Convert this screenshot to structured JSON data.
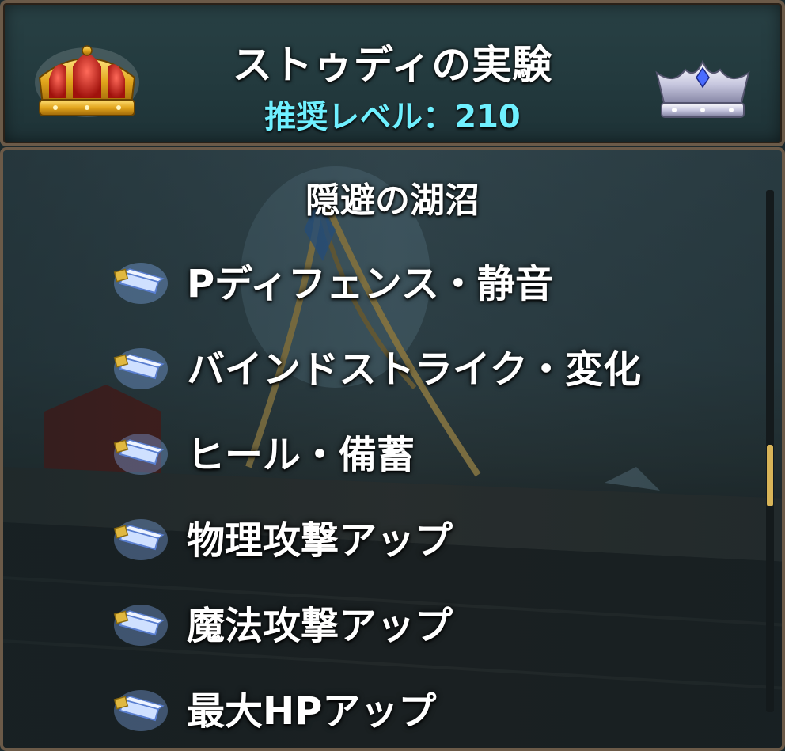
{
  "header": {
    "title": "ストゥディの実験",
    "recommended_level": "推奨レベル：210",
    "left_icon": "gold-crown-icon",
    "right_icon": "silver-crown-icon"
  },
  "section": {
    "title": "隠避の湖沼"
  },
  "skills": [
    {
      "label": "Pディフェンス・静音",
      "icon": "scroll-crystal-icon"
    },
    {
      "label": "バインドストライク・変化",
      "icon": "scroll-crystal-icon"
    },
    {
      "label": "ヒール・備蓄",
      "icon": "scroll-crystal-icon"
    },
    {
      "label": "物理攻撃アップ",
      "icon": "scroll-crystal-icon"
    },
    {
      "label": "魔法攻撃アップ",
      "icon": "scroll-crystal-icon"
    },
    {
      "label": "最大HPアップ",
      "icon": "scroll-crystal-icon"
    }
  ],
  "colors": {
    "level_text": "#6ff0ff",
    "frame": "#6b5a48",
    "scroll_thumb": "#d8b458"
  },
  "scroll": {
    "position_fraction": 0.49
  }
}
